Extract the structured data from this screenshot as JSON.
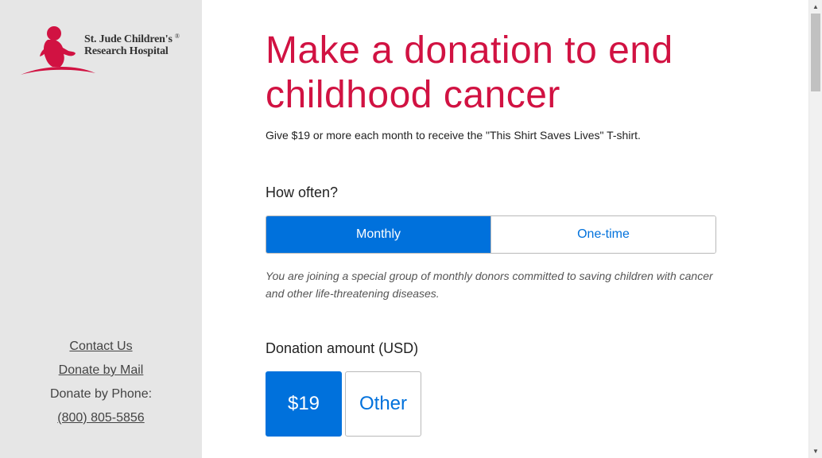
{
  "logo": {
    "line1": "St. Jude Children's",
    "line2": "Research Hospital",
    "reg_mark": "®",
    "icon": "st-jude-child-silhouette-logo"
  },
  "sidebar": {
    "contact_us": "Contact Us",
    "donate_by_mail": "Donate by Mail",
    "donate_by_phone_label": "Donate by Phone:",
    "phone_number": "(800) 805-5856"
  },
  "main": {
    "title": "Make a donation to end childhood cancer",
    "subtitle": "Give $19 or more each month to receive the \"This Shirt Saves Lives\" T-shirt.",
    "frequency": {
      "label": "How often?",
      "options": [
        "Monthly",
        "One-time"
      ],
      "selected": "Monthly",
      "note": "You are joining a special group of monthly donors committed to saving children with cancer and other life-threatening diseases."
    },
    "amount": {
      "label": "Donation amount (USD)",
      "options": [
        "$19",
        "Other"
      ],
      "selected": "$19"
    }
  },
  "colors": {
    "brand_red": "#d11242",
    "accent_blue": "#0071dc",
    "sidebar_bg": "#e6e6e6"
  }
}
